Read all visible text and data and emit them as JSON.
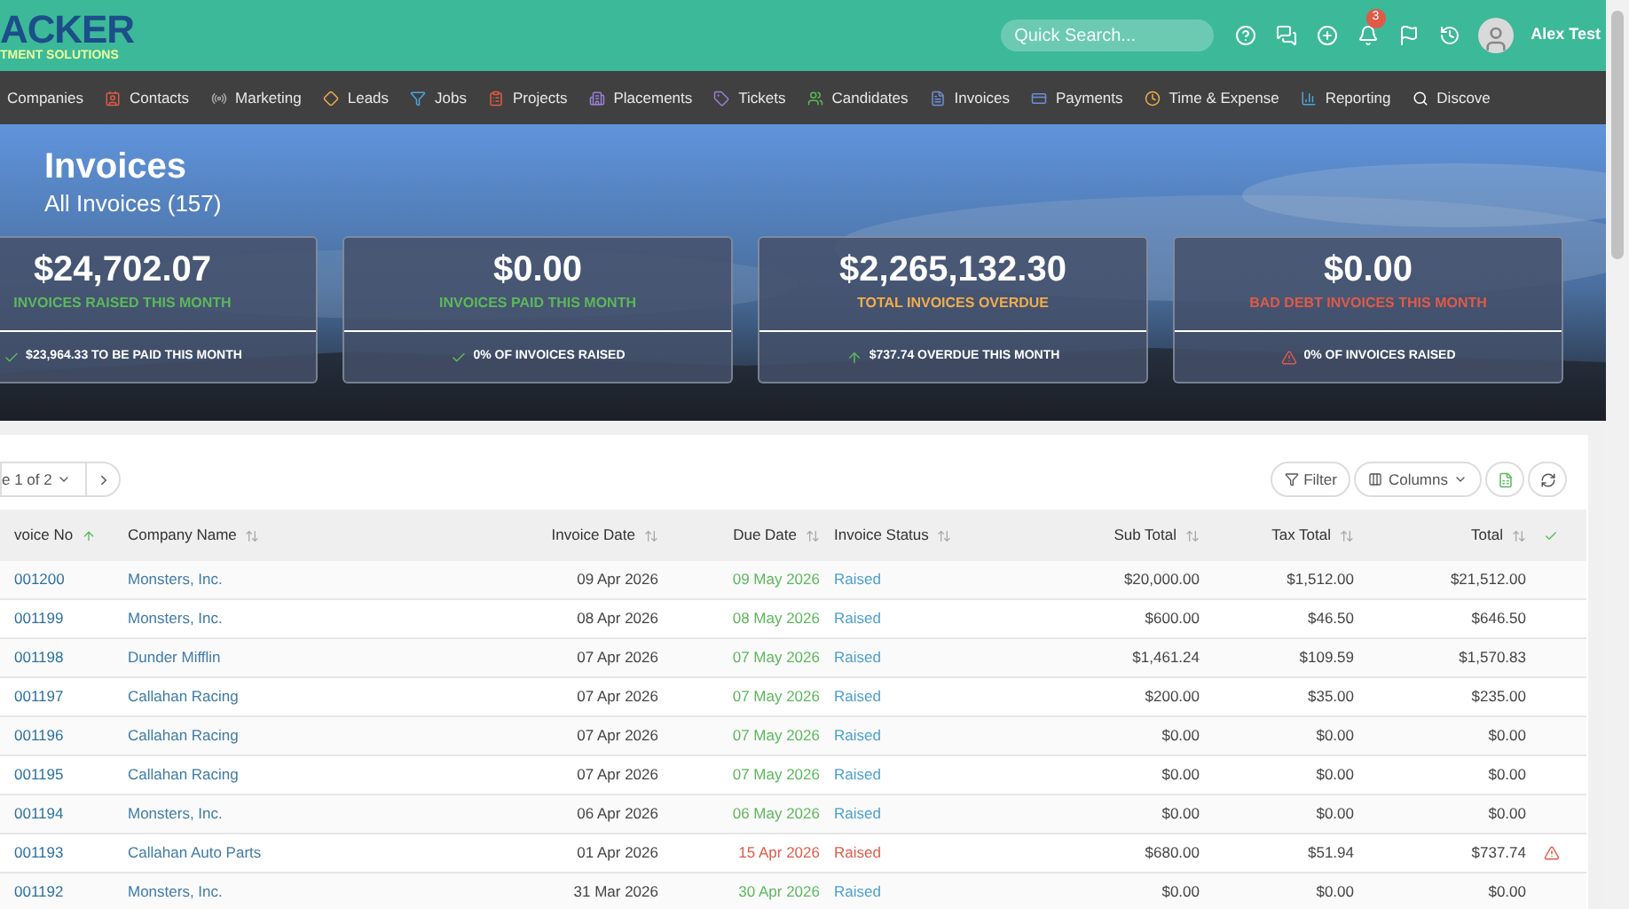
{
  "topbar": {
    "logo": "ACKER",
    "logo_tagline": "TMENT SOLUTIONS",
    "search": {
      "placeholder": "Quick Search..."
    },
    "notifications_badge": "3",
    "user": "Alex Test"
  },
  "nav": [
    {
      "label": "Companies"
    },
    {
      "label": "Contacts"
    },
    {
      "label": "Marketing"
    },
    {
      "label": "Leads"
    },
    {
      "label": "Jobs"
    },
    {
      "label": "Projects"
    },
    {
      "label": "Placements"
    },
    {
      "label": "Tickets"
    },
    {
      "label": "Candidates"
    },
    {
      "label": "Invoices"
    },
    {
      "label": "Payments"
    },
    {
      "label": "Time & Expense"
    },
    {
      "label": "Reporting"
    },
    {
      "label": "Discove"
    }
  ],
  "header": {
    "title": "Invoices",
    "subtitle": "All Invoices (157)"
  },
  "stats": [
    {
      "value": "$24,702.07",
      "label": "INVOICES RAISED THIS MONTH",
      "color": "#5cb85c",
      "footer": "$23,964.33 TO BE PAID THIS MONTH",
      "kind": "check"
    },
    {
      "value": "$0.00",
      "label": "INVOICES PAID THIS MONTH",
      "color": "#5cb85c",
      "footer": "0% OF INVOICES RAISED",
      "kind": "check"
    },
    {
      "value": "$2,265,132.30",
      "label": "TOTAL INVOICES OVERDUE",
      "color": "#f0ad4e",
      "footer": "$737.74 OVERDUE THIS MONTH",
      "kind": "up"
    },
    {
      "value": "$0.00",
      "label": "BAD DEBT INVOICES THIS MONTH",
      "color": "#e05a47",
      "footer": "0% OF INVOICES RAISED",
      "kind": "warning"
    }
  ],
  "toolbar": {
    "page": "e 1 of 2",
    "filter": "Filter",
    "columns": "Columns"
  },
  "table": {
    "columns": [
      "voice No",
      "Company Name",
      "Invoice Date",
      "Due Date",
      "Invoice Status",
      "Sub Total",
      "Tax Total",
      "Total"
    ],
    "rows": [
      {
        "no": "001200",
        "company": "Monsters, Inc.",
        "invoice_date": "09 Apr 2026",
        "due_date": "09 May 2026",
        "status": "Raised",
        "sub_total": "$20,000.00",
        "tax_total": "$1,512.00",
        "total": "$21,512.00",
        "overdue": false
      },
      {
        "no": "001199",
        "company": "Monsters, Inc.",
        "invoice_date": "08 Apr 2026",
        "due_date": "08 May 2026",
        "status": "Raised",
        "sub_total": "$600.00",
        "tax_total": "$46.50",
        "total": "$646.50",
        "overdue": false
      },
      {
        "no": "001198",
        "company": "Dunder Mifflin",
        "invoice_date": "07 Apr 2026",
        "due_date": "07 May 2026",
        "status": "Raised",
        "sub_total": "$1,461.24",
        "tax_total": "$109.59",
        "total": "$1,570.83",
        "overdue": false
      },
      {
        "no": "001197",
        "company": "Callahan Racing",
        "invoice_date": "07 Apr 2026",
        "due_date": "07 May 2026",
        "status": "Raised",
        "sub_total": "$200.00",
        "tax_total": "$35.00",
        "total": "$235.00",
        "overdue": false
      },
      {
        "no": "001196",
        "company": "Callahan Racing",
        "invoice_date": "07 Apr 2026",
        "due_date": "07 May 2026",
        "status": "Raised",
        "sub_total": "$0.00",
        "tax_total": "$0.00",
        "total": "$0.00",
        "overdue": false
      },
      {
        "no": "001195",
        "company": "Callahan Racing",
        "invoice_date": "07 Apr 2026",
        "due_date": "07 May 2026",
        "status": "Raised",
        "sub_total": "$0.00",
        "tax_total": "$0.00",
        "total": "$0.00",
        "overdue": false
      },
      {
        "no": "001194",
        "company": "Monsters, Inc.",
        "invoice_date": "06 Apr 2026",
        "due_date": "06 May 2026",
        "status": "Raised",
        "sub_total": "$0.00",
        "tax_total": "$0.00",
        "total": "$0.00",
        "overdue": false
      },
      {
        "no": "001193",
        "company": "Callahan Auto Parts",
        "invoice_date": "01 Apr 2026",
        "due_date": "15 Apr 2026",
        "status": "Raised",
        "sub_total": "$680.00",
        "tax_total": "$51.94",
        "total": "$737.74",
        "overdue": true
      },
      {
        "no": "001192",
        "company": "Monsters, Inc.",
        "invoice_date": "31 Mar 2026",
        "due_date": "30 Apr 2026",
        "status": "Raised",
        "sub_total": "$0.00",
        "tax_total": "$0.00",
        "total": "$0.00",
        "overdue": false
      }
    ]
  }
}
